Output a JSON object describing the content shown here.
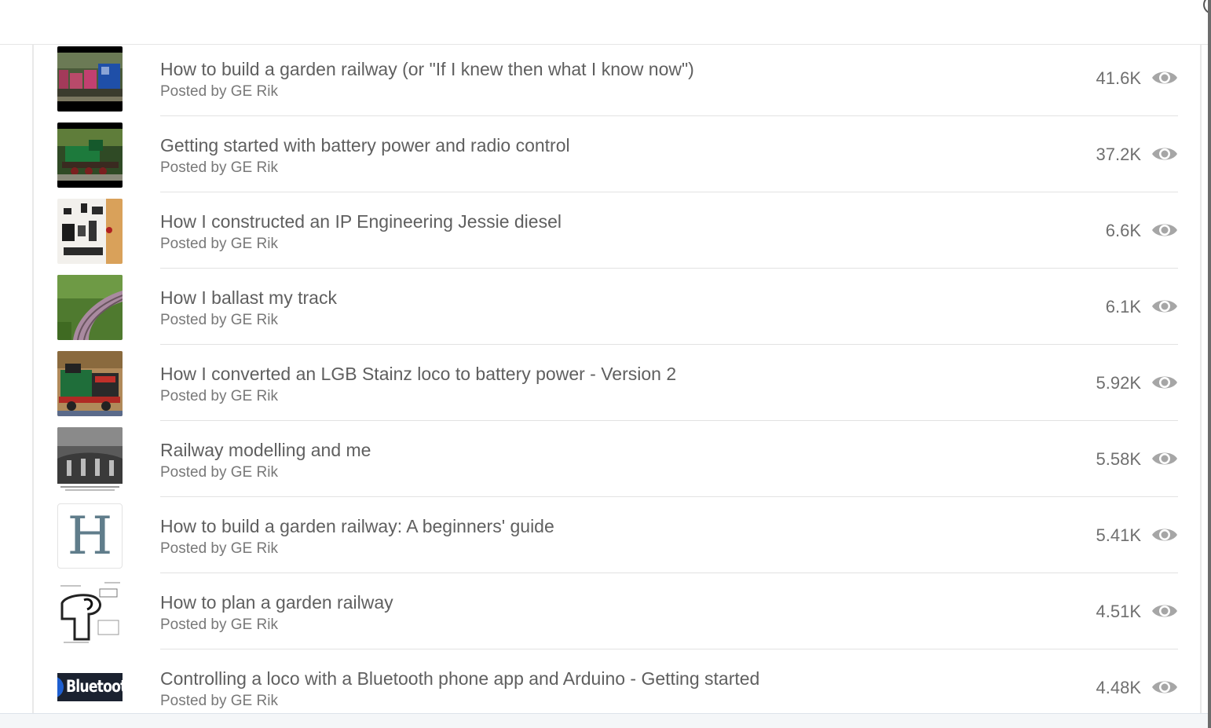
{
  "posts": [
    {
      "title": "How to build a garden railway (or \"If I knew then what I know now\")",
      "byline": "Posted by GE Rik",
      "views": "41.6K",
      "thumb": "railway-wagons"
    },
    {
      "title": "Getting started with battery power and radio control",
      "byline": "Posted by GE Rik",
      "views": "37.2K",
      "thumb": "green-locomotive"
    },
    {
      "title": "How I constructed an IP Engineering Jessie diesel",
      "byline": "Posted by GE Rik",
      "views": "6.6K",
      "thumb": "kit-parts"
    },
    {
      "title": "How I ballast my track",
      "byline": "Posted by GE Rik",
      "views": "6.1K",
      "thumb": "garden-track"
    },
    {
      "title": "How I converted an LGB Stainz loco to battery power - Version 2",
      "byline": "Posted by GE Rik",
      "views": "5.92K",
      "thumb": "stainz-loco"
    },
    {
      "title": "Railway modelling and me",
      "byline": "Posted by GE Rik",
      "views": "5.58K",
      "thumb": "bw-photo"
    },
    {
      "title": "How to build a garden railway: A beginners' guide",
      "byline": "Posted by GE Rik",
      "views": "5.41K",
      "thumb": "letter-H",
      "thumb_letter": "H"
    },
    {
      "title": "How to plan a garden railway",
      "byline": "Posted by GE Rik",
      "views": "4.51K",
      "thumb": "track-plan-sketch"
    },
    {
      "title": "Controlling a loco with a Bluetooth phone app and Arduino - Getting started",
      "byline": "Posted by GE Rik",
      "views": "4.48K",
      "thumb": "bluetooth-logo",
      "thumb_text": "Bluetoot"
    }
  ],
  "icons": {
    "views": "eye-icon"
  },
  "colors": {
    "text": "#5f5f5f",
    "muted": "#787878",
    "icon": "#9e9e9e",
    "divider": "#e2e2e2"
  }
}
